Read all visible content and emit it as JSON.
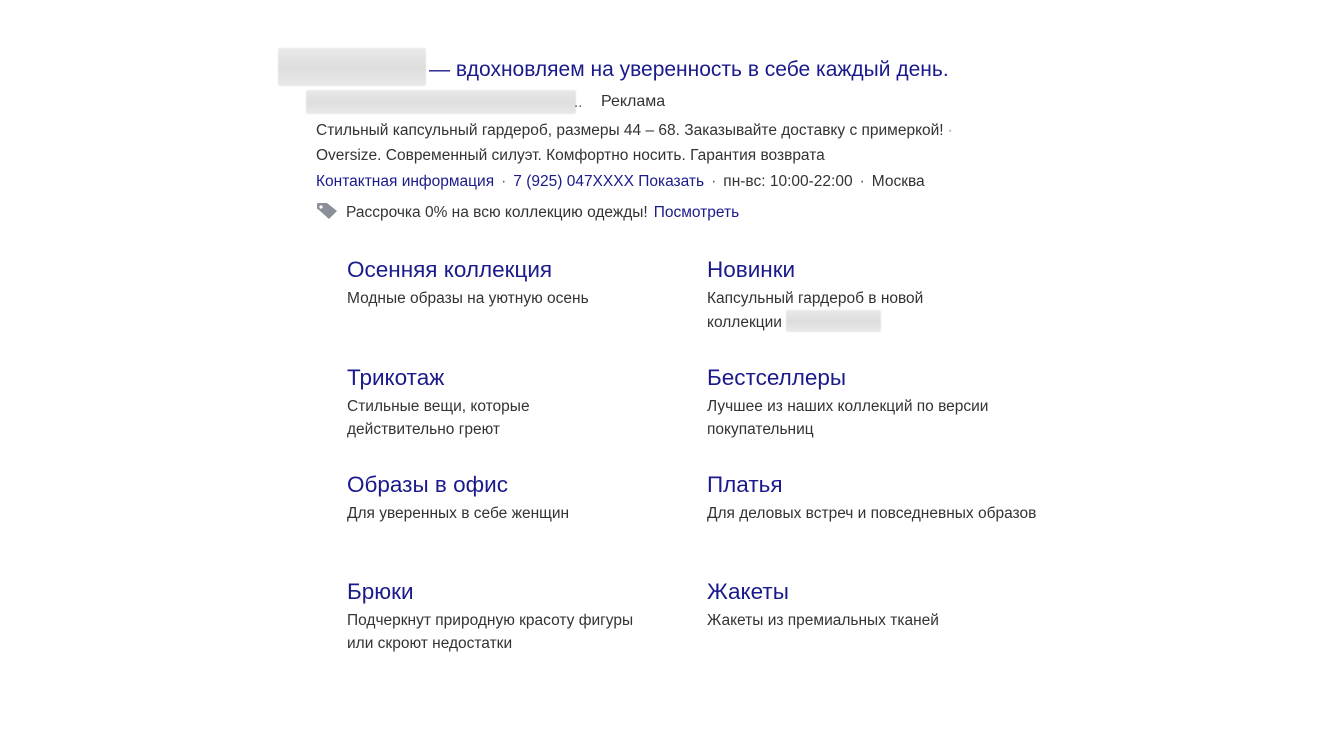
{
  "ad": {
    "title": "— вдохновляем на уверенность в себе каждый день.",
    "url_ellipsis": "..",
    "ad_label": "Реклама",
    "description_line1": "Стильный капсульный гардероб, размеры 44 – 68. Заказывайте доставку с примеркой!",
    "description_sep": "·",
    "description_line2": "Oversize. Современный силуэт. Комфортно носить. Гарантия возврата",
    "contacts": {
      "contact_info": "Контактная информация",
      "phone": "7 (925) 047XXXX Показать",
      "hours": "пн-вс: 10:00-22:00",
      "city": "Москва",
      "separator": "·"
    },
    "promo": {
      "icon": "tag-icon",
      "text": "Рассрочка 0% на всю коллекцию одежды!",
      "link": "Посмотреть"
    }
  },
  "sitelinks": [
    {
      "title": "Осенняя коллекция",
      "desc": "Модные образы на уютную осень"
    },
    {
      "title": "Новинки",
      "desc": "Капсульный гардероб в новой коллекции"
    },
    {
      "title": "Трикотаж",
      "desc": "Стильные вещи, которые действительно греют"
    },
    {
      "title": "Бестселлеры",
      "desc": "Лучшее из наших коллекций по версии покупательниц"
    },
    {
      "title": "Образы в офис",
      "desc": "Для уверенных в себе женщин"
    },
    {
      "title": "Платья",
      "desc": "Для деловых встреч и повседневных образов"
    },
    {
      "title": "Брюки",
      "desc": "Подчеркнут природную красоту фигуры или скроют недостатки"
    },
    {
      "title": "Жакеты",
      "desc": "Жакеты из премиальных тканей"
    }
  ],
  "colors": {
    "link": "#1a1a8c",
    "text": "#333333",
    "icon": "#8a8f99"
  }
}
